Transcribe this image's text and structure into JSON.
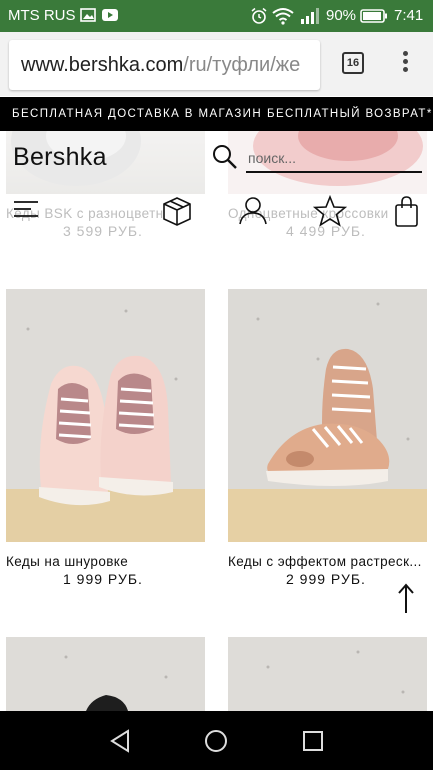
{
  "status_bar": {
    "carrier": "MTS RUS",
    "battery_percent": "90%",
    "time": "7:41",
    "icons": [
      "image-icon",
      "youtube-icon",
      "alarm-icon",
      "wifi-icon",
      "signal-icon",
      "battery-icon"
    ]
  },
  "browser": {
    "url_host": "www.bershka.com",
    "url_path": "/ru/туфли/же",
    "tab_count": "16"
  },
  "promo": {
    "left": "БЕСПЛАТНАЯ ДОСТАВКА В МАГАЗИН",
    "right": "БЕСПЛАТНЫЙ ВОЗВРАТ*"
  },
  "header": {
    "logo": "Bershka",
    "search_placeholder": "поиск...",
    "icons": [
      "menu-icon",
      "box-icon",
      "user-icon",
      "star-icon",
      "bag-icon"
    ]
  },
  "products": [
    {
      "name": "Кеды BSK с разноцветн",
      "price": "3 599 РУБ."
    },
    {
      "name": "Одноцветные кроссовки",
      "price": "4 499 РУБ."
    },
    {
      "name": "Кеды на шнуровке",
      "price": "1 999 РУБ."
    },
    {
      "name": "Кеды с эффектом растреск...",
      "price": "2 999 РУБ."
    }
  ],
  "colors": {
    "status_bar": "#3a7a3a",
    "promo_bg": "#000000",
    "nav_bar": "#000000"
  }
}
